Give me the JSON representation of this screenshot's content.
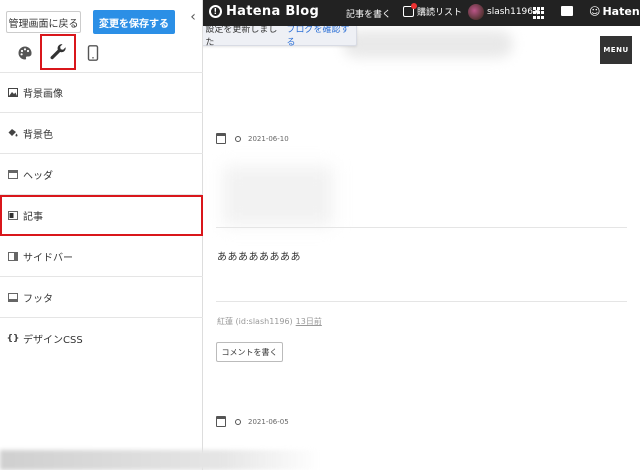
{
  "sidebar": {
    "back_button": "管理画面に戻る",
    "save_button": "変更を保存する",
    "collapse_icon": "chevron-left-icon",
    "tabs": [
      {
        "name": "design",
        "icon": "palette-icon"
      },
      {
        "name": "customize",
        "icon": "wrench-icon",
        "active": true
      },
      {
        "name": "smartphone",
        "icon": "smartphone-icon"
      }
    ],
    "items": [
      {
        "label": "背景画像",
        "icon": "image-icon"
      },
      {
        "label": "背景色",
        "icon": "paint-bucket-icon"
      },
      {
        "label": "ヘッダ",
        "icon": "header-icon"
      },
      {
        "label": "記事",
        "icon": "article-icon",
        "selected": true
      },
      {
        "label": "サイドバー",
        "icon": "sidebar-icon"
      },
      {
        "label": "フッタ",
        "icon": "footer-icon"
      },
      {
        "label": "デザインCSS",
        "icon": "braces-icon"
      }
    ],
    "highlight_color": "#d9161b"
  },
  "topbar": {
    "logo": "Hatena Blog",
    "write": "記事を書く",
    "reading_list": "購読リスト",
    "username": "slash1196",
    "brand": "Hatena"
  },
  "preview": {
    "toast": {
      "message": "設定を更新しました",
      "link": "ブログを確認する"
    },
    "menu_button": "MENU",
    "entries": [
      {
        "date": "2021-06-10"
      },
      {
        "date": "2021-06-05"
      }
    ],
    "body_text": "ああああああああ",
    "author": "紅蓮 (id:slash1196)",
    "time_ago": "13日前",
    "comment_button": "コメントを書く"
  },
  "colors": {
    "accent_blue": "#2b8fe6",
    "topbar_bg": "#222222"
  }
}
